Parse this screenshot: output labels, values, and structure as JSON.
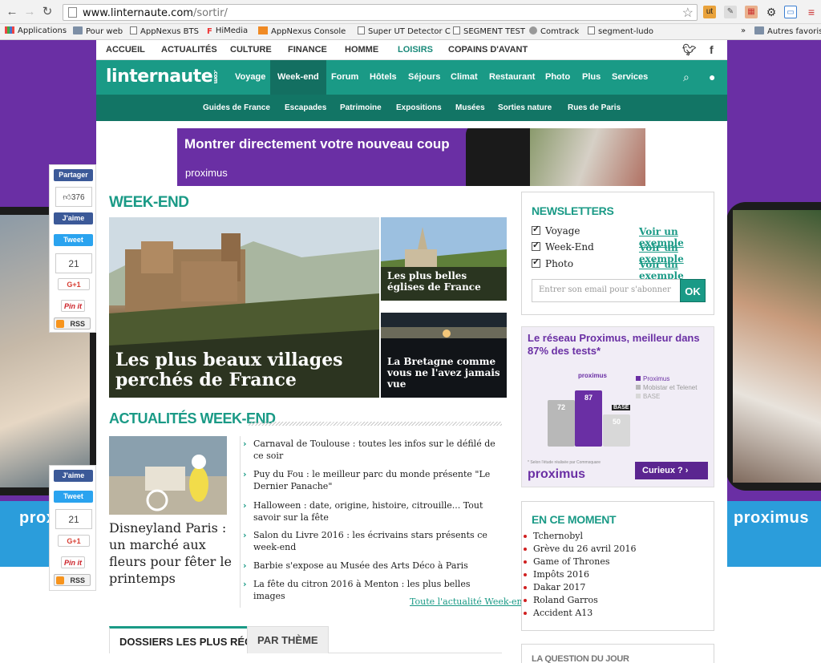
{
  "browser": {
    "url_host": "www.linternaute.com",
    "url_path": "/sortir/",
    "bookmarks": [
      "Applications",
      "Pour web",
      "AppNexus BTS",
      "HiMedia",
      "AppNexus Console",
      "Super UT Detector C",
      "SEGMENT TEST",
      "Comtrack",
      "segment-ludo"
    ],
    "more_bookmarks": "»",
    "other_bookmarks": "Autres favoris"
  },
  "topnav": {
    "items": [
      "ACCUEIL",
      "ACTUALITÉS",
      "CULTURE",
      "FINANCE",
      "HOMME",
      "LOISIRS",
      "COPAINS D'AVANT"
    ]
  },
  "site": {
    "logo": "linternaute",
    "logo_suffix": ".com",
    "nav": [
      "Voyage",
      "Week-end",
      "Forum",
      "Hôtels",
      "Séjours",
      "Climat",
      "Restaurant",
      "Photo",
      "Plus",
      "Services"
    ],
    "subnav": [
      "Guides de France",
      "Escapades",
      "Patrimoine",
      "Expositions",
      "Musées",
      "Sorties nature",
      "Rues de Paris"
    ]
  },
  "banner_ad": {
    "text": "Montrer directement votre nouveau coup",
    "brand": "proximus"
  },
  "weekend": {
    "heading": "WEEK-END",
    "hero_caption": "Les plus beaux villages perchés de France",
    "tile1_caption": "Les plus belles églises de France",
    "tile2_caption": "La Bretagne comme vous ne l'avez jamais vue"
  },
  "actu": {
    "heading": "ACTUALITÉS WEEK-END",
    "feature_title": "Disneyland Paris : un marché aux fleurs pour fêter le printemps",
    "items": [
      "Carnaval de Toulouse : toutes les infos sur le défilé de ce soir",
      "Puy du Fou : le meilleur parc du monde présente \"Le Dernier Panache\"",
      "Halloween : date, origine, histoire, citrouille... Tout savoir sur la fête",
      "Salon du Livre 2016 : les écrivains stars présents ce week-end",
      "Barbie s'expose au Musée des Arts Déco à Paris",
      "La fête du citron 2016 à Menton : les plus belles images"
    ],
    "more_link": "Toute l'actualité Week-end"
  },
  "tabs": [
    "DOSSIERS LES PLUS RÉCENTS",
    "PAR THÈME"
  ],
  "newsletters": {
    "title": "NEWSLETTERS",
    "options": [
      "Voyage",
      "Week-End",
      "Photo"
    ],
    "example_link": "Voir un exemple",
    "email_placeholder": "Entrer son email pour s'abonner",
    "ok": "OK"
  },
  "right_ad": {
    "headline": "Le réseau Proximus, meilleur dans 87% des tests*",
    "bars": [
      {
        "label": "Proximus",
        "value": 87,
        "color": "#6a2fa4"
      },
      {
        "label": "Mobistar et Telenet",
        "value": 72,
        "color": "#b8b8b8"
      },
      {
        "label": "BASE",
        "value": 50,
        "color": "#d8d8d8"
      }
    ],
    "bar_top_label": "proximus",
    "base_badge": "BASE",
    "note": "* Selon l'étude réalisée par Commsquare",
    "brand": "proximus",
    "cta": "Curieux ?"
  },
  "moment": {
    "title": "EN CE MOMENT",
    "items": [
      "Tchernobyl",
      "Grève du 26 avril 2016",
      "Game of Thrones",
      "Impôts 2016",
      "Dakar 2017",
      "Roland Garros",
      "Accident A13"
    ]
  },
  "question": {
    "title": "LA QUESTION DU JOUR"
  },
  "share_top": {
    "share": "Partager",
    "like_count": "376",
    "like": "J'aime",
    "tweet": "Tweet",
    "count": "21",
    "gplus": "G+1",
    "pin": "Pin it",
    "rss": "RSS"
  },
  "share_bottom": {
    "like": "J'aime",
    "tweet": "Tweet",
    "count": "21",
    "gplus": "G+1",
    "pin": "Pin it",
    "rss": "RSS"
  },
  "skin": {
    "brand": "proximus"
  }
}
